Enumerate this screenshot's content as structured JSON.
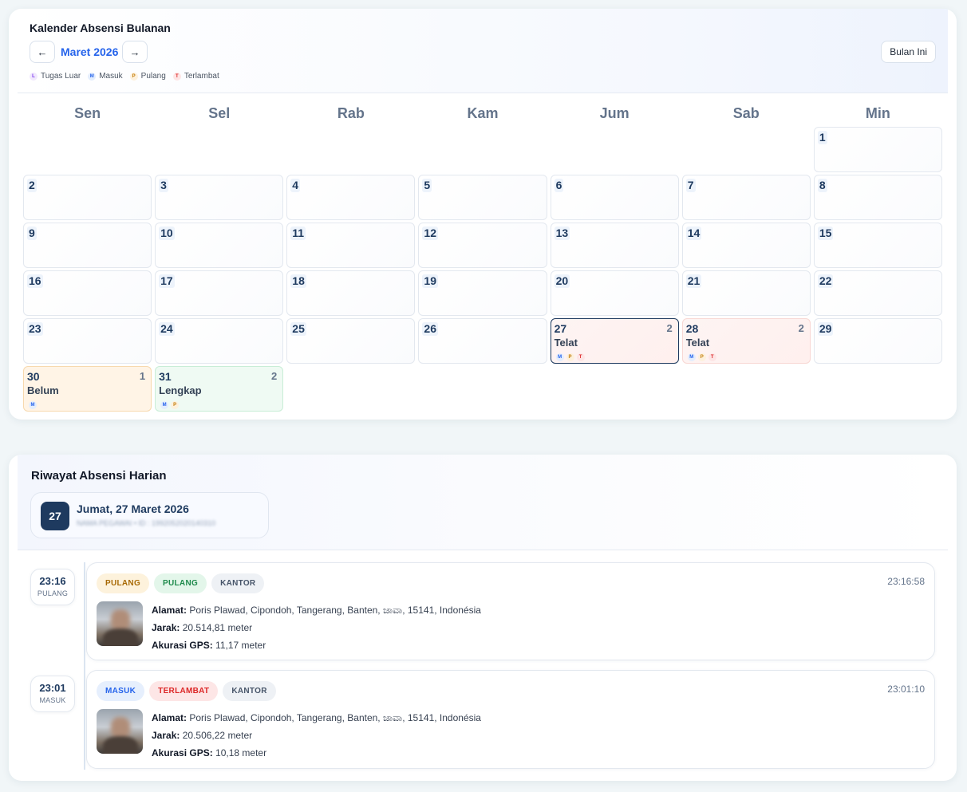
{
  "calendar": {
    "title": "Kalender Absensi Bulanan",
    "prev_label": "←",
    "next_label": "→",
    "month_label": "Maret 2026",
    "today_label": "Bulan Ini",
    "legend": [
      {
        "code": "L",
        "label": "Tugas Luar"
      },
      {
        "code": "M",
        "label": "Masuk"
      },
      {
        "code": "P",
        "label": "Pulang"
      },
      {
        "code": "T",
        "label": "Terlambat"
      }
    ],
    "weekdays": [
      "Sen",
      "Sel",
      "Rab",
      "Kam",
      "Jum",
      "Sab",
      "Min"
    ],
    "leading_empty": 6,
    "days": [
      {
        "num": "1"
      },
      {
        "num": "2"
      },
      {
        "num": "3"
      },
      {
        "num": "4"
      },
      {
        "num": "5"
      },
      {
        "num": "6"
      },
      {
        "num": "7"
      },
      {
        "num": "8"
      },
      {
        "num": "9"
      },
      {
        "num": "10"
      },
      {
        "num": "11"
      },
      {
        "num": "12"
      },
      {
        "num": "13"
      },
      {
        "num": "14"
      },
      {
        "num": "15"
      },
      {
        "num": "16"
      },
      {
        "num": "17"
      },
      {
        "num": "18"
      },
      {
        "num": "19"
      },
      {
        "num": "20"
      },
      {
        "num": "21"
      },
      {
        "num": "22"
      },
      {
        "num": "23"
      },
      {
        "num": "24"
      },
      {
        "num": "25"
      },
      {
        "num": "26"
      },
      {
        "num": "27",
        "count": "2",
        "status": "Telat",
        "kind": "telat",
        "selected": true,
        "dots": [
          "M",
          "P",
          "T"
        ]
      },
      {
        "num": "28",
        "count": "2",
        "status": "Telat",
        "kind": "telat",
        "dots": [
          "M",
          "P",
          "T"
        ]
      },
      {
        "num": "29"
      },
      {
        "num": "30",
        "count": "1",
        "status": "Belum",
        "kind": "belum",
        "dots": [
          "M"
        ]
      },
      {
        "num": "31",
        "count": "2",
        "status": "Lengkap",
        "kind": "lengkap",
        "dots": [
          "M",
          "P"
        ]
      }
    ]
  },
  "history": {
    "title": "Riwayat Absensi Harian",
    "date_badge": "27",
    "date_label": "Jumat, 27 Maret 2026",
    "date_sub": "NAMA PEGAWAI • ID : 1992052020140310",
    "entries": [
      {
        "chip_time": "23:16",
        "chip_label": "PULANG",
        "tags": [
          {
            "label": "PULANG",
            "kind": "pulang"
          },
          {
            "label": "PULANG",
            "kind": "lengkap"
          },
          {
            "label": "KANTOR",
            "kind": "kantor"
          }
        ],
        "time": "23:16:58",
        "alamat_label": "Alamat:",
        "alamat": "Poris Plawad, Cipondoh, Tangerang, Banten, ಜಾವಾ, 15141, Indonésia",
        "jarak_label": "Jarak:",
        "jarak": "20.514,81 meter",
        "gps_label": "Akurasi GPS:",
        "gps": "11,17 meter"
      },
      {
        "chip_time": "23:01",
        "chip_label": "MASUK",
        "tags": [
          {
            "label": "MASUK",
            "kind": "masuk"
          },
          {
            "label": "TERLAMBAT",
            "kind": "terlambat"
          },
          {
            "label": "KANTOR",
            "kind": "kantor"
          }
        ],
        "time": "23:01:10",
        "alamat_label": "Alamat:",
        "alamat": "Poris Plawad, Cipondoh, Tangerang, Banten, ಜಾವಾ, 15141, Indonésia",
        "jarak_label": "Jarak:",
        "jarak": "20.506,22 meter",
        "gps_label": "Akurasi GPS:",
        "gps": "10,18 meter"
      }
    ]
  }
}
